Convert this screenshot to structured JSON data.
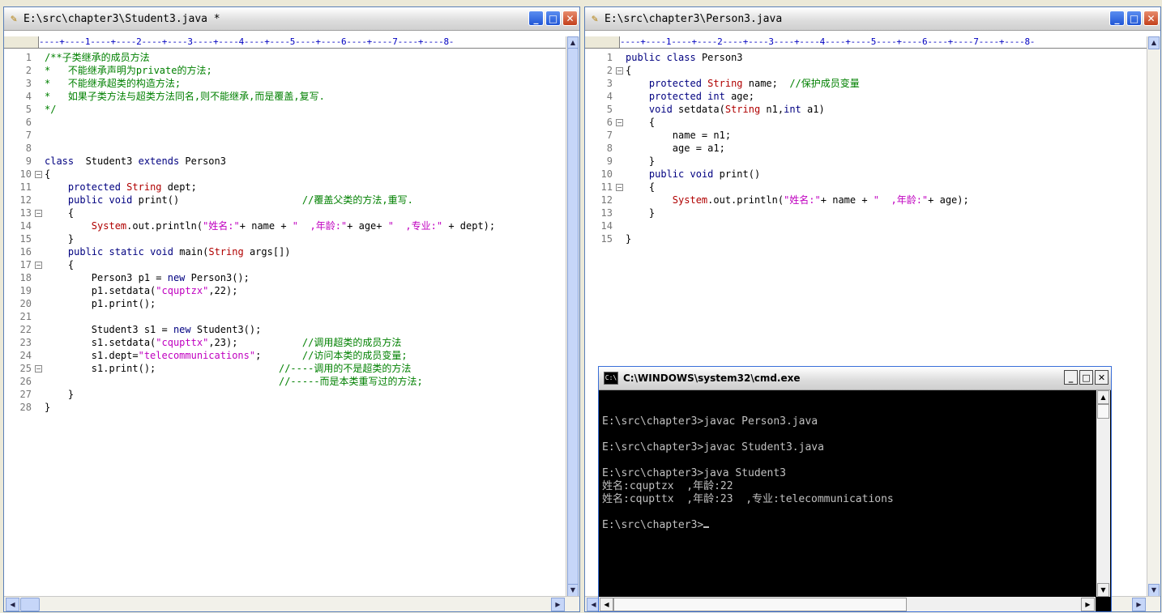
{
  "left_editor": {
    "title": "E:\\src\\chapter3\\Student3.java *",
    "ruler": "----+----1----+----2----+----3----+----4----+----5----+----6----+----7----+----8-",
    "lines": [
      {
        "n": "1",
        "segs": [
          [
            "com",
            "/**子类继承的成员方法"
          ]
        ]
      },
      {
        "n": "2",
        "segs": [
          [
            "com",
            "*   不能继承声明为private的方法;"
          ]
        ]
      },
      {
        "n": "3",
        "segs": [
          [
            "com",
            "*   不能继承超类的构造方法;"
          ]
        ]
      },
      {
        "n": "4",
        "segs": [
          [
            "com",
            "*   如果子类方法与超类方法同名,则不能继承,而是覆盖,复写."
          ]
        ]
      },
      {
        "n": "5",
        "segs": [
          [
            "com",
            "*/"
          ]
        ]
      },
      {
        "n": "6",
        "segs": []
      },
      {
        "n": "7",
        "segs": []
      },
      {
        "n": "8",
        "segs": []
      },
      {
        "n": "9",
        "segs": [
          [
            "kw",
            "class"
          ],
          [
            "",
            "  Student3 "
          ],
          [
            "kw",
            "extends"
          ],
          [
            "",
            " Person3"
          ]
        ]
      },
      {
        "n": "10",
        "fold": true,
        "segs": [
          [
            "",
            "{"
          ]
        ]
      },
      {
        "n": "11",
        "segs": [
          [
            "",
            "    "
          ],
          [
            "kw",
            "protected"
          ],
          [
            "",
            " "
          ],
          [
            "ty",
            "String"
          ],
          [
            "",
            " dept;"
          ]
        ]
      },
      {
        "n": "12",
        "segs": [
          [
            "",
            "    "
          ],
          [
            "kw",
            "public"
          ],
          [
            "",
            " "
          ],
          [
            "kw",
            "void"
          ],
          [
            "",
            " print()                     "
          ],
          [
            "com",
            "//覆盖父类的方法,重写."
          ]
        ]
      },
      {
        "n": "13",
        "fold": true,
        "segs": [
          [
            "",
            "    {"
          ]
        ]
      },
      {
        "n": "14",
        "segs": [
          [
            "",
            "        "
          ],
          [
            "ty",
            "System"
          ],
          [
            "",
            ".out.println("
          ],
          [
            "str",
            "\"姓名:\""
          ],
          [
            "",
            "+ name + "
          ],
          [
            "str",
            "\"  ,年龄:\""
          ],
          [
            "",
            "+ age+ "
          ],
          [
            "str",
            "\"  ,专业:\""
          ],
          [
            "",
            " + dept);"
          ]
        ]
      },
      {
        "n": "15",
        "segs": [
          [
            "",
            "    }"
          ]
        ]
      },
      {
        "n": "16",
        "segs": [
          [
            "",
            "    "
          ],
          [
            "kw",
            "public"
          ],
          [
            "",
            " "
          ],
          [
            "kw",
            "static"
          ],
          [
            "",
            " "
          ],
          [
            "kw",
            "void"
          ],
          [
            "",
            " main("
          ],
          [
            "ty",
            "String"
          ],
          [
            "",
            " args[])"
          ]
        ]
      },
      {
        "n": "17",
        "fold": true,
        "segs": [
          [
            "",
            "    {"
          ]
        ]
      },
      {
        "n": "18",
        "segs": [
          [
            "",
            "        Person3 p1 = "
          ],
          [
            "kw",
            "new"
          ],
          [
            "",
            " Person3();"
          ]
        ]
      },
      {
        "n": "19",
        "segs": [
          [
            "",
            "        p1.setdata("
          ],
          [
            "str",
            "\"cquptzx\""
          ],
          [
            "",
            ",22);"
          ]
        ]
      },
      {
        "n": "20",
        "segs": [
          [
            "",
            "        p1.print();"
          ]
        ]
      },
      {
        "n": "21",
        "segs": []
      },
      {
        "n": "22",
        "segs": [
          [
            "",
            "        Student3 s1 = "
          ],
          [
            "kw",
            "new"
          ],
          [
            "",
            " Student3();"
          ]
        ]
      },
      {
        "n": "23",
        "segs": [
          [
            "",
            "        s1.setdata("
          ],
          [
            "str",
            "\"cqupttx\""
          ],
          [
            "",
            ",23);           "
          ],
          [
            "com",
            "//调用超类的成员方法"
          ]
        ]
      },
      {
        "n": "24",
        "segs": [
          [
            "",
            "        s1.dept="
          ],
          [
            "str",
            "\"telecommunications\""
          ],
          [
            "",
            ";       "
          ],
          [
            "com",
            "//访问本类的成员变量;"
          ]
        ]
      },
      {
        "n": "25",
        "fold": true,
        "segs": [
          [
            "",
            "        s1.print();                     "
          ],
          [
            "com",
            "//----调用的不是超类的方法"
          ]
        ]
      },
      {
        "n": "26",
        "segs": [
          [
            "",
            "                                        "
          ],
          [
            "com",
            "//-----而是本类重写过的方法;"
          ]
        ]
      },
      {
        "n": "27",
        "segs": [
          [
            "",
            "    }"
          ]
        ]
      },
      {
        "n": "28",
        "segs": [
          [
            "",
            "}"
          ]
        ]
      }
    ]
  },
  "right_editor": {
    "title": "E:\\src\\chapter3\\Person3.java",
    "ruler": "----+----1----+----2----+----3----+----4----+----5----+----6----+----7----+----8-",
    "lines": [
      {
        "n": "1",
        "segs": [
          [
            "kw",
            "public"
          ],
          [
            "",
            " "
          ],
          [
            "kw",
            "class"
          ],
          [
            "",
            " Person3"
          ]
        ]
      },
      {
        "n": "2",
        "fold": true,
        "segs": [
          [
            "",
            "{"
          ]
        ]
      },
      {
        "n": "3",
        "segs": [
          [
            "",
            "    "
          ],
          [
            "kw",
            "protected"
          ],
          [
            "",
            " "
          ],
          [
            "ty",
            "String"
          ],
          [
            "",
            " name;  "
          ],
          [
            "com",
            "//保护成员变量"
          ]
        ]
      },
      {
        "n": "4",
        "segs": [
          [
            "",
            "    "
          ],
          [
            "kw",
            "protected"
          ],
          [
            "",
            " "
          ],
          [
            "kw",
            "int"
          ],
          [
            "",
            " age;"
          ]
        ]
      },
      {
        "n": "5",
        "segs": [
          [
            "",
            "    "
          ],
          [
            "kw",
            "void"
          ],
          [
            "",
            " setdata("
          ],
          [
            "ty",
            "String"
          ],
          [
            "",
            " n1,"
          ],
          [
            "kw",
            "int"
          ],
          [
            "",
            " a1)"
          ]
        ]
      },
      {
        "n": "6",
        "fold": true,
        "segs": [
          [
            "",
            "    {"
          ]
        ]
      },
      {
        "n": "7",
        "segs": [
          [
            "",
            "        name = n1;"
          ]
        ]
      },
      {
        "n": "8",
        "segs": [
          [
            "",
            "        age = a1;"
          ]
        ]
      },
      {
        "n": "9",
        "segs": [
          [
            "",
            "    }"
          ]
        ]
      },
      {
        "n": "10",
        "segs": [
          [
            "",
            "    "
          ],
          [
            "kw",
            "public"
          ],
          [
            "",
            " "
          ],
          [
            "kw",
            "void"
          ],
          [
            "",
            " print()"
          ]
        ]
      },
      {
        "n": "11",
        "fold": true,
        "segs": [
          [
            "",
            "    {"
          ]
        ]
      },
      {
        "n": "12",
        "segs": [
          [
            "",
            "        "
          ],
          [
            "ty",
            "System"
          ],
          [
            "",
            ".out.println("
          ],
          [
            "str",
            "\"姓名:\""
          ],
          [
            "",
            "+ name + "
          ],
          [
            "str",
            "\"  ,年龄:\""
          ],
          [
            "",
            "+ age);"
          ]
        ]
      },
      {
        "n": "13",
        "segs": [
          [
            "",
            "    }"
          ]
        ]
      },
      {
        "n": "14",
        "segs": []
      },
      {
        "n": "15",
        "segs": [
          [
            "",
            "}"
          ]
        ]
      }
    ]
  },
  "cmd": {
    "title": "C:\\WINDOWS\\system32\\cmd.exe",
    "lines": [
      "",
      "E:\\src\\chapter3>javac Person3.java",
      "",
      "E:\\src\\chapter3>javac Student3.java",
      "",
      "E:\\src\\chapter3>java Student3",
      "姓名:cquptzx  ,年龄:22",
      "姓名:cqupttx  ,年龄:23  ,专业:telecommunications",
      "",
      "E:\\src\\chapter3>"
    ]
  }
}
